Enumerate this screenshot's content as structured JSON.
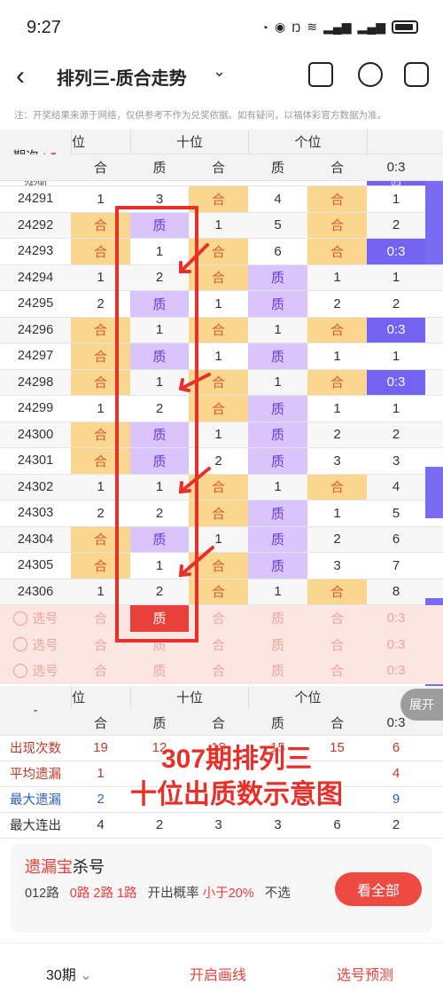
{
  "status": {
    "time": "9:27",
    "signal": "6"
  },
  "header": {
    "title": "排列三-质合走势",
    "note": "注：开奖结果来源于网络，仅供参考不作为兑奖依据。如有疑问，以福体彩官方数据为准。"
  },
  "table": {
    "col_groups": [
      "位",
      "十位",
      "个位"
    ],
    "period_header": "期次",
    "sub_headers": [
      "合",
      "质",
      "合",
      "质",
      "合",
      "0:3"
    ],
    "partial_row": [
      "24290",
      "",
      "",
      "",
      "",
      "",
      "0:3"
    ],
    "rows": [
      {
        "period": "24291",
        "c": [
          "1",
          "3",
          "合",
          "4",
          "合",
          "1"
        ]
      },
      {
        "period": "24292",
        "c": [
          "合",
          "质",
          "1",
          "5",
          "合",
          "2"
        ]
      },
      {
        "period": "24293",
        "c": [
          "合",
          "1",
          "合",
          "6",
          "合",
          "0:3"
        ]
      },
      {
        "period": "24294",
        "c": [
          "1",
          "2",
          "合",
          "质",
          "1",
          "1"
        ]
      },
      {
        "period": "24295",
        "c": [
          "2",
          "质",
          "1",
          "质",
          "2",
          "2"
        ]
      },
      {
        "period": "24296",
        "c": [
          "合",
          "1",
          "合",
          "1",
          "合",
          "0:3"
        ]
      },
      {
        "period": "24297",
        "c": [
          "合",
          "质",
          "1",
          "质",
          "1",
          "1"
        ]
      },
      {
        "period": "24298",
        "c": [
          "合",
          "1",
          "合",
          "1",
          "合",
          "0:3"
        ]
      },
      {
        "period": "24299",
        "c": [
          "1",
          "2",
          "合",
          "质",
          "1",
          "1"
        ]
      },
      {
        "period": "24300",
        "c": [
          "合",
          "质",
          "1",
          "质",
          "2",
          "2"
        ]
      },
      {
        "period": "24301",
        "c": [
          "合",
          "质",
          "2",
          "质",
          "3",
          "3"
        ]
      },
      {
        "period": "24302",
        "c": [
          "1",
          "1",
          "合",
          "1",
          "合",
          "4"
        ]
      },
      {
        "period": "24303",
        "c": [
          "2",
          "2",
          "合",
          "质",
          "1",
          "5"
        ]
      },
      {
        "period": "24304",
        "c": [
          "合",
          "质",
          "1",
          "质",
          "2",
          "6"
        ]
      },
      {
        "period": "24305",
        "c": [
          "合",
          "1",
          "合",
          "质",
          "3",
          "7"
        ]
      },
      {
        "period": "24306",
        "c": [
          "1",
          "2",
          "合",
          "1",
          "合",
          "8"
        ]
      }
    ],
    "select_label": "选号",
    "select_rows": [
      [
        "合",
        "质",
        "合",
        "质",
        "合",
        "0:3"
      ],
      [
        "合",
        "质",
        "合",
        "质",
        "合",
        "0:3"
      ],
      [
        "合",
        "质",
        "合",
        "质",
        "合",
        "0:3"
      ]
    ],
    "footer_dash": "-",
    "stats": [
      {
        "label": "出现次数",
        "v": [
          "19",
          "12",
          "18",
          "15",
          "15",
          "6"
        ],
        "color": "#c0392b"
      },
      {
        "label": "平均遗漏",
        "v": [
          "1",
          "",
          "",
          "",
          "",
          "4"
        ],
        "color": "#c0392b"
      },
      {
        "label": "最大遗漏",
        "v": [
          "2",
          "",
          "",
          "",
          "",
          "9"
        ],
        "color": "#2f5fb3"
      },
      {
        "label": "最大连出",
        "v": [
          "4",
          "2",
          "3",
          "3",
          "6",
          "2"
        ],
        "color": "#333"
      }
    ],
    "expand": "展开"
  },
  "overlay": {
    "line1": "307期排列三",
    "line2": "十位出质数示意图"
  },
  "card": {
    "title_red": "遗漏宝",
    "title_rest": "杀号",
    "line_prefix": "012路",
    "line_red": "0路 2路 1路",
    "line_mid": "开出概率",
    "line_red2": "小于20%",
    "line_tail": "不选",
    "button": "看全部"
  },
  "bottom": {
    "periods": "30期",
    "draw": "开启画线",
    "predict": "选号预测"
  }
}
